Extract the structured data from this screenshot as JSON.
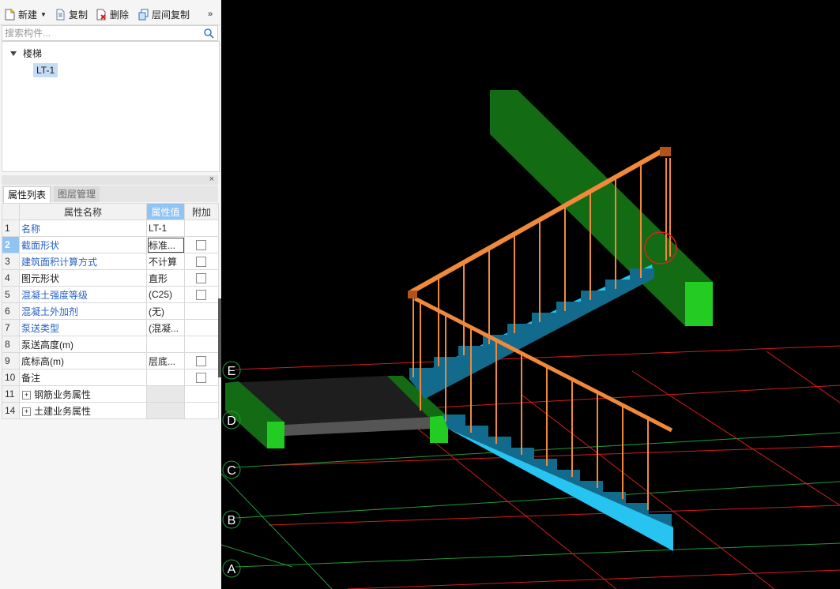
{
  "toolbar": {
    "new_label": "新建",
    "copy_label": "复制",
    "delete_label": "删除",
    "floor_copy_label": "层间复制",
    "more_label": "»"
  },
  "search": {
    "placeholder": "搜索构件..."
  },
  "tree": {
    "root_label": "楼梯",
    "item_label": "LT-1"
  },
  "panel": {
    "close_label": "×",
    "tabs": [
      "属性列表",
      "图层管理"
    ]
  },
  "grid": {
    "headers": [
      "属性名称",
      "属性值",
      "附加"
    ],
    "rows": [
      {
        "num": "1",
        "name": "名称",
        "value": "LT-1",
        "extra": false
      },
      {
        "num": "2",
        "name": "截面形状",
        "value": "标准...",
        "extra": true
      },
      {
        "num": "3",
        "name": "建筑面积计算方式",
        "value": "不计算",
        "extra": true
      },
      {
        "num": "4",
        "name": "图元形状",
        "value": "直形",
        "extra": true
      },
      {
        "num": "5",
        "name": "混凝土强度等级",
        "value": "(C25)",
        "extra": true
      },
      {
        "num": "6",
        "name": "混凝土外加剂",
        "value": "(无)",
        "extra": false
      },
      {
        "num": "7",
        "name": "泵送类型",
        "value": "(混凝...",
        "extra": false
      },
      {
        "num": "8",
        "name": "泵送高度(m)",
        "value": "",
        "extra": false
      },
      {
        "num": "9",
        "name": "底标高(m)",
        "value": "层底...",
        "extra": true
      },
      {
        "num": "10",
        "name": "备注",
        "value": "",
        "extra": true
      },
      {
        "num": "11",
        "name": "钢筋业务属性",
        "value": "",
        "extra": false
      },
      {
        "num": "14",
        "name": "土建业务属性",
        "value": "",
        "extra": false
      }
    ]
  },
  "axes": [
    "E",
    "D",
    "C",
    "B",
    "A"
  ],
  "colors": {
    "viewport_bg": "#000000",
    "beam": "#136b13",
    "beam_end": "#22cc22",
    "stair": "#27c4f2",
    "stair_dark": "#126a8c",
    "railing": "#f08a3a",
    "grid_red": "#d41c1c",
    "grid_green": "#1f9a3a"
  }
}
